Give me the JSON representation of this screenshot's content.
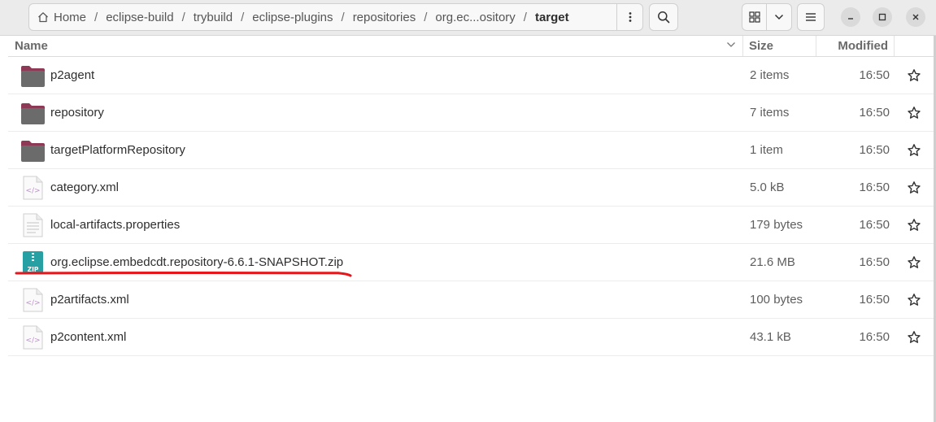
{
  "breadcrumb": {
    "items": [
      "Home",
      "eclipse-build",
      "trybuild",
      "eclipse-plugins",
      "repositories",
      "org.ec...ository",
      "target"
    ],
    "separator": "/"
  },
  "columns": {
    "name": "Name",
    "size": "Size",
    "modified": "Modified"
  },
  "files": [
    {
      "name": "p2agent",
      "size": "2 items",
      "modified": "16:50",
      "icon": "folder-icon"
    },
    {
      "name": "repository",
      "size": "7 items",
      "modified": "16:50",
      "icon": "folder-icon"
    },
    {
      "name": "targetPlatformRepository",
      "size": "1 item",
      "modified": "16:50",
      "icon": "folder-icon"
    },
    {
      "name": "category.xml",
      "size": "5.0 kB",
      "modified": "16:50",
      "icon": "xml-file-icon"
    },
    {
      "name": "local-artifacts.properties",
      "size": "179 bytes",
      "modified": "16:50",
      "icon": "text-file-icon"
    },
    {
      "name": "org.eclipse.embedcdt.repository-6.6.1-SNAPSHOT.zip",
      "size": "21.6 MB",
      "modified": "16:50",
      "icon": "zip-file-icon",
      "annotated": true
    },
    {
      "name": "p2artifacts.xml",
      "size": "100 bytes",
      "modified": "16:50",
      "icon": "xml-file-icon"
    },
    {
      "name": "p2content.xml",
      "size": "43.1 kB",
      "modified": "16:50",
      "icon": "xml-file-icon"
    }
  ],
  "icons": {
    "zip_label": "ZIP",
    "xml_label": "</>"
  },
  "colors": {
    "folder_body": "#6b6b6b",
    "folder_tab": "#8e3a57",
    "zip_teal": "#27a0a4",
    "xml_accent": "#c48bd6",
    "annotation_red": "#e8161b"
  }
}
